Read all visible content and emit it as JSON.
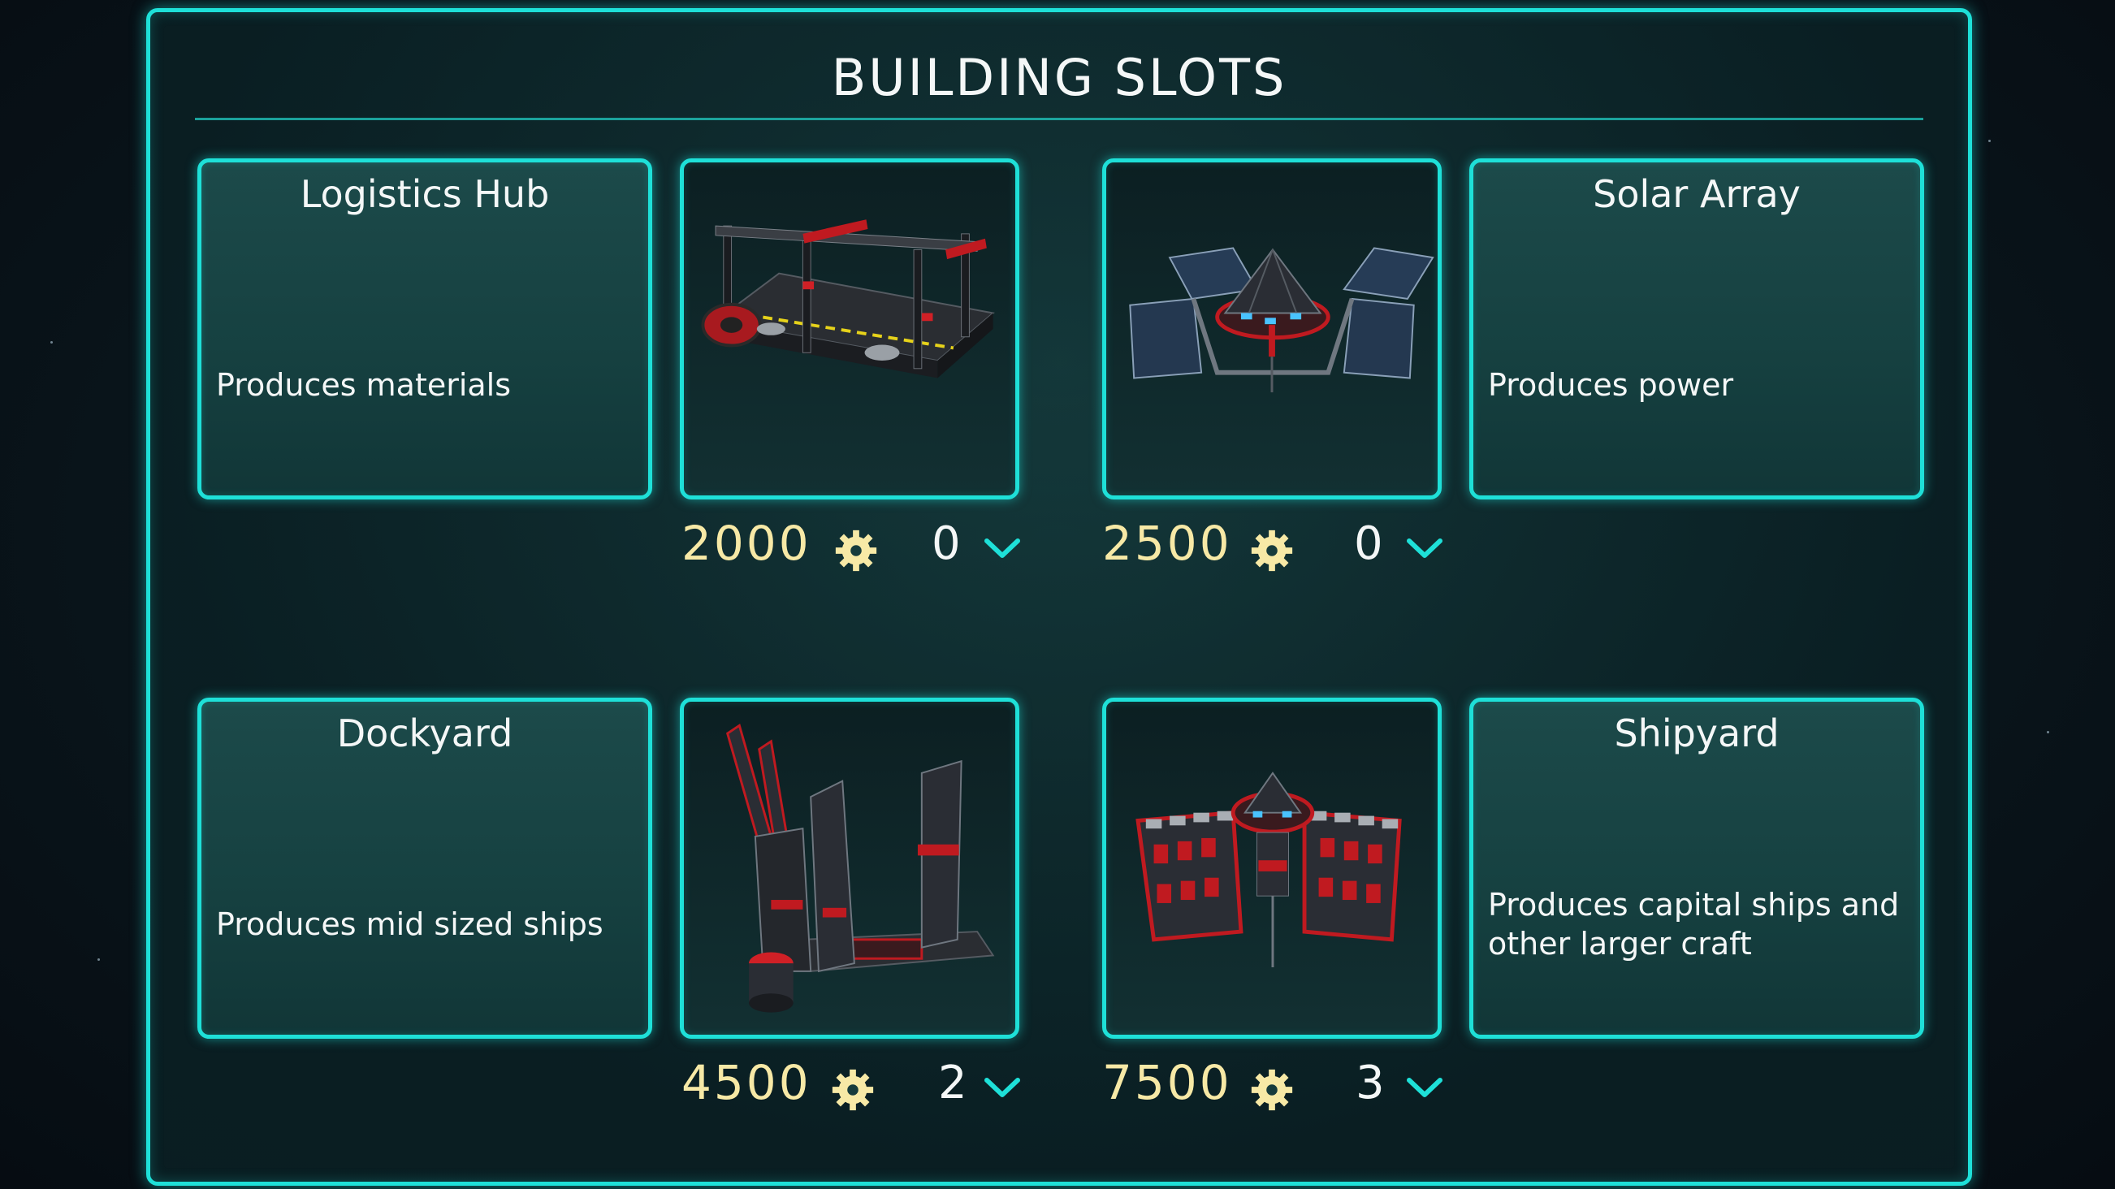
{
  "title": "BUILDING SLOTS",
  "slots": [
    {
      "name": "Logistics Hub",
      "description": "Produces materials",
      "cost": "2000",
      "count": "0"
    },
    {
      "name": "Solar Array",
      "description": "Produces power",
      "cost": "2500",
      "count": "0"
    },
    {
      "name": "Dockyard",
      "description": "Produces mid sized ships",
      "cost": "4500",
      "count": "2"
    },
    {
      "name": "Shipyard",
      "description": "Produces capital ships and other larger craft",
      "cost": "7500",
      "count": "3"
    }
  ],
  "icons": {
    "cost": "gear-icon",
    "expand": "chevron-down-icon"
  },
  "colors": {
    "accent": "#1ee0d8",
    "cost_text": "#f7e9a6",
    "building_red": "#d02026"
  }
}
